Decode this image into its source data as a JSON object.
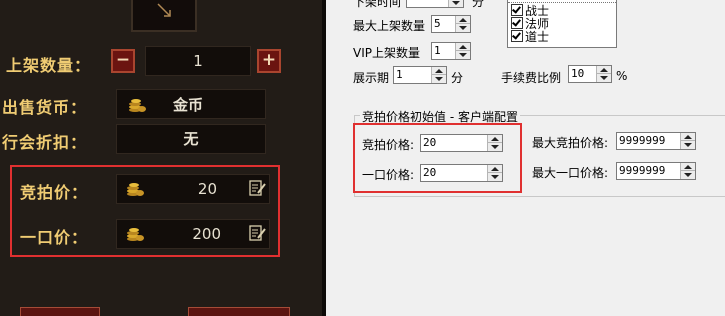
{
  "game_panel": {
    "quantity": {
      "label": "上架数量：",
      "value": "1",
      "minus": "−",
      "plus": "+"
    },
    "currency": {
      "label": "出售货币：",
      "value": "金币"
    },
    "guild_discount": {
      "label": "行会折扣：",
      "value": "无"
    },
    "bid_price": {
      "label": "竞拍价：",
      "value": "20"
    },
    "buyout_price": {
      "label": "一口价：",
      "value": "200"
    },
    "colors": {
      "label": "#f0cc73",
      "highlight": "#e03030",
      "background": "#221c17"
    },
    "icons": [
      "item-arrow-icon",
      "coin-icon",
      "edit-icon"
    ]
  },
  "config_dialog": {
    "top_partial": {
      "label": "下架时间",
      "unit": "分"
    },
    "max_listings": {
      "label": "最大上架数量",
      "value": "5"
    },
    "vip_listings": {
      "label": "VIP上架数量",
      "value": "1"
    },
    "display_period": {
      "label": "展示期",
      "value": "1",
      "unit": "分"
    },
    "fee_ratio": {
      "label": "手续费比例",
      "value": "10",
      "unit": "%"
    },
    "classes": [
      {
        "label": "战士",
        "checked": true
      },
      {
        "label": "法师",
        "checked": true
      },
      {
        "label": "道士",
        "checked": true
      }
    ],
    "initial_group": {
      "title": "竞拍价格初始值 - 客户端配置",
      "bid_price": {
        "label": "竞拍价格:",
        "value": "20"
      },
      "buyout_price": {
        "label": "一口价格:",
        "value": "20"
      },
      "max_bid_price": {
        "label": "最大竞拍价格:",
        "value": "9999999"
      },
      "max_buyout_price": {
        "label": "最大一口价格:",
        "value": "9999999"
      }
    },
    "colors": {
      "highlight": "#e03030",
      "background": "#f0f0f0"
    }
  }
}
